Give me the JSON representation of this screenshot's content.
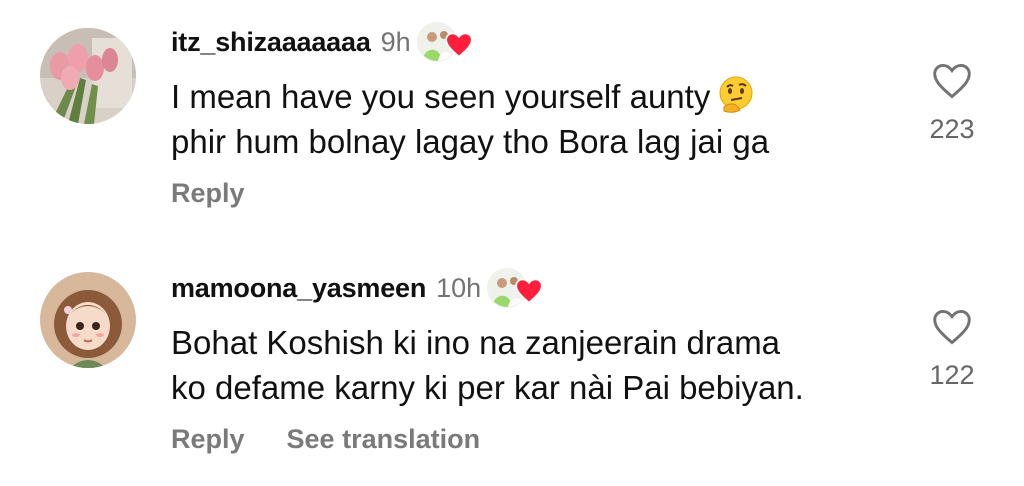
{
  "comments": [
    {
      "username": "itz_shizaaaaaaa",
      "time": "9h",
      "lines": [
        "I mean have you seen yourself aunty",
        "phir hum bolnay lagay  tho Bora lag jai ga"
      ],
      "emoji": "thinking-face",
      "likes": "223",
      "actions": {
        "reply": "Reply"
      }
    },
    {
      "username": "mamoona_yasmeen",
      "time": "10h",
      "lines": [
        "Bohat Koshish ki ino na zanjeerain drama",
        "ko defame karny ki per kar nài Pai bebiyan."
      ],
      "likes": "122",
      "actions": {
        "reply": "Reply",
        "translate": "See translation"
      }
    }
  ],
  "colors": {
    "heart_red": "#ff1f3d",
    "muted": "#737373"
  }
}
